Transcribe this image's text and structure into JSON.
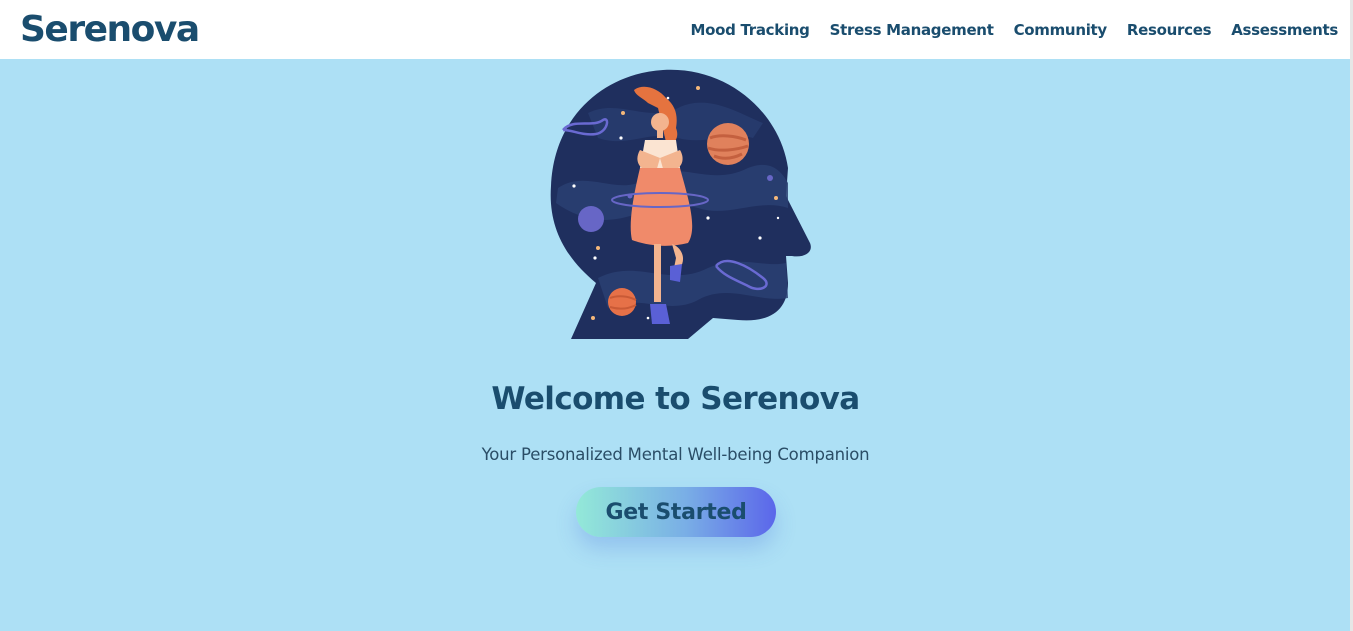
{
  "brand": {
    "name": "Serenova"
  },
  "nav": {
    "items": [
      {
        "label": "Mood Tracking"
      },
      {
        "label": "Stress Management"
      },
      {
        "label": "Community"
      },
      {
        "label": "Resources"
      },
      {
        "label": "Assessments"
      }
    ]
  },
  "hero": {
    "illustration": "head-silhouette-meditation-illustration",
    "title": "Welcome to Serenova",
    "subtitle": "Your Personalized Mental Well-being Companion",
    "cta_label": "Get Started"
  },
  "colors": {
    "primary_text": "#1a4d6e",
    "hero_background": "#ade0f5",
    "header_background": "#ffffff",
    "cta_gradient_start": "#93e9d8",
    "cta_gradient_end": "#5b66ea"
  }
}
